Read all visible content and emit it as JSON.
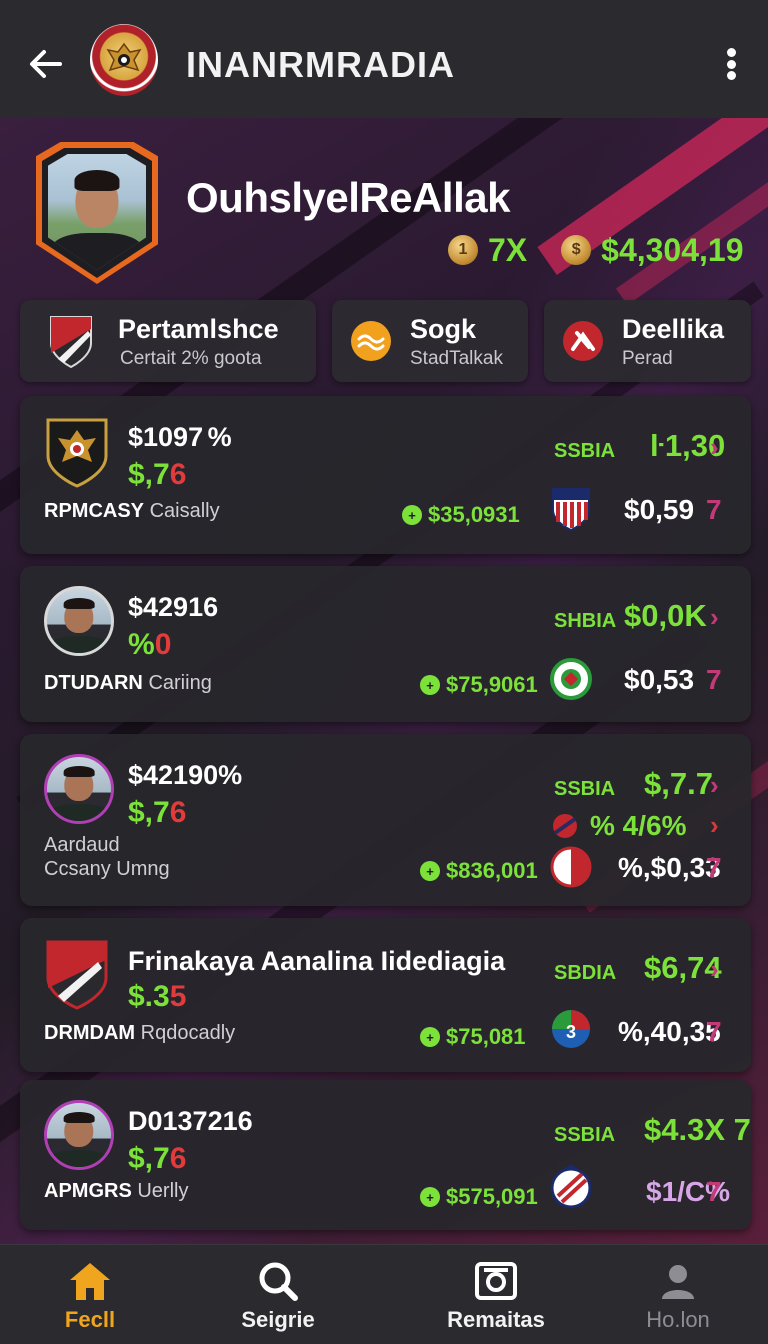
{
  "header": {
    "title": "INANRMRADIA",
    "back_icon": "arrow-left-icon",
    "menu_icon": "more-vertical-icon"
  },
  "profile": {
    "name": "OuhslyelReAllak",
    "stat_1": "7X",
    "stat_1_coin": "1",
    "stat_2": "$4,304,19",
    "stat_2_coin": "$"
  },
  "tiles": [
    {
      "title": "Pertamlshce",
      "subtitle": "Certait 2% goota",
      "icon": "club-shield-icon"
    },
    {
      "title": "Sogk",
      "subtitle": "StadTalkak",
      "icon": "wave-coin-icon"
    },
    {
      "title": "Deellika",
      "subtitle": "Perad",
      "icon": "red-fist-icon"
    }
  ],
  "cards": [
    {
      "price": "$1097 %",
      "change": "$,76",
      "label_bold": "RPMCASY",
      "label": "Caisally",
      "mid": "$35,0931",
      "exchange": "SSBIA",
      "rate": "ŀ1,30",
      "value": "$0,59",
      "avatar": "garuda-emblem-icon"
    },
    {
      "price": "$42916",
      "change": "%0",
      "label_bold": "DTUDARN",
      "label": "Cariing",
      "mid": "$75,9061",
      "exchange": "SHBIA",
      "rate": "$0,0K",
      "value": "$0,53",
      "avatar": "player-avatar"
    },
    {
      "price": "$42190%",
      "change": "$,76",
      "label_bold": "",
      "label": "Aardaud",
      "label_line2": "Ccsany Umng",
      "mid": "$836,001",
      "exchange": "SSBIA",
      "rate": "$,7.7",
      "rate2": "% 4/6%",
      "value": "%,$0,33",
      "avatar": "player-avatar"
    },
    {
      "price": "Frinakaya Aanalina Iidediagia",
      "change": "$.35",
      "label_bold": "DRMDAM",
      "label": "Rqdocadly",
      "mid": "$75,081",
      "exchange": "SBDIA",
      "rate": "$6,74",
      "value": "%,40,35",
      "avatar": "club-shield-icon"
    },
    {
      "price": "D0137216",
      "change": "$,76",
      "label_bold": "APMGRS",
      "label": "Uerlly",
      "mid": "$575,091",
      "exchange": "SSBIA",
      "rate": "$4.3X 7",
      "value": "$1/C%",
      "avatar": "player-avatar"
    }
  ],
  "nav": [
    {
      "label": "Fecll",
      "icon": "home-icon",
      "active": true
    },
    {
      "label": "Seigrie",
      "icon": "search-icon"
    },
    {
      "label": "Remaitas",
      "icon": "camera-box-icon"
    },
    {
      "label": "Ho.lon",
      "icon": "profile-icon"
    }
  ],
  "colors": {
    "accent_green": "#7ce23a",
    "accent_red": "#e23b3b",
    "accent_orange": "#f0a51e",
    "chevron_pink": "#c23a78",
    "header_bg": "#2b2a2f"
  }
}
